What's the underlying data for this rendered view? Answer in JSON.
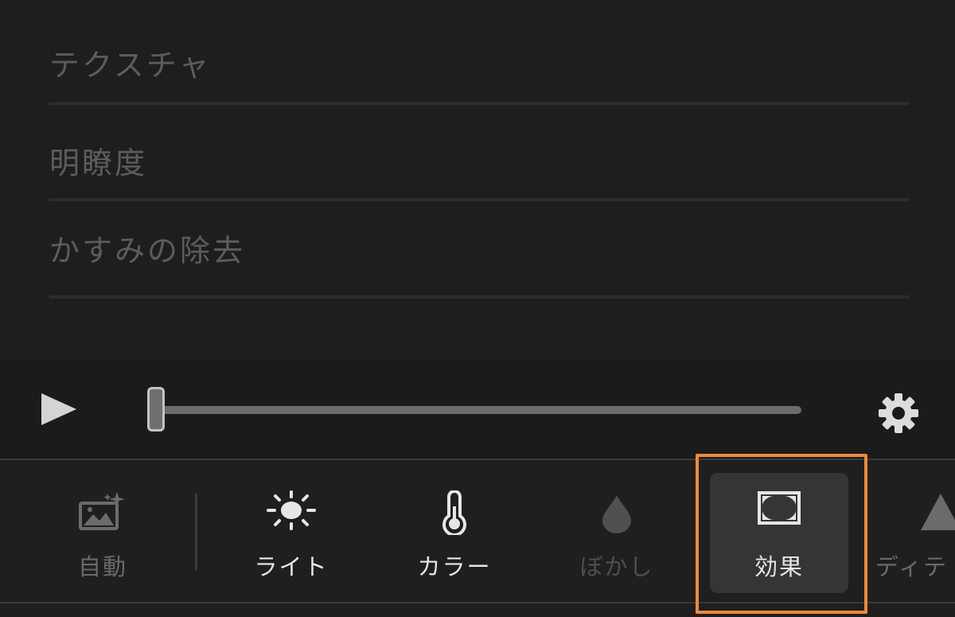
{
  "adjustments": {
    "items": [
      {
        "label": "テクスチャ"
      },
      {
        "label": "明瞭度"
      },
      {
        "label": "かすみの除去"
      }
    ]
  },
  "playback": {
    "play_icon": "play-icon",
    "settings_icon": "gear-icon",
    "position_fraction": 0.0
  },
  "toolbar": {
    "tools": [
      {
        "label": "自動",
        "icon": "auto-enhance-icon",
        "state": "normal"
      },
      {
        "label": "ライト",
        "icon": "sun-icon",
        "state": "normal"
      },
      {
        "label": "カラー",
        "icon": "thermometer-icon",
        "state": "normal"
      },
      {
        "label": "ぼかし",
        "icon": "droplet-icon",
        "state": "disabled"
      },
      {
        "label": "効果",
        "icon": "vignette-icon",
        "state": "selected"
      },
      {
        "label": "ディテ",
        "icon": "triangle-icon",
        "state": "normal"
      }
    ]
  },
  "colors": {
    "background": "#1f1f1f",
    "highlight": "#ef8a3a",
    "selected_tile": "#353535"
  }
}
